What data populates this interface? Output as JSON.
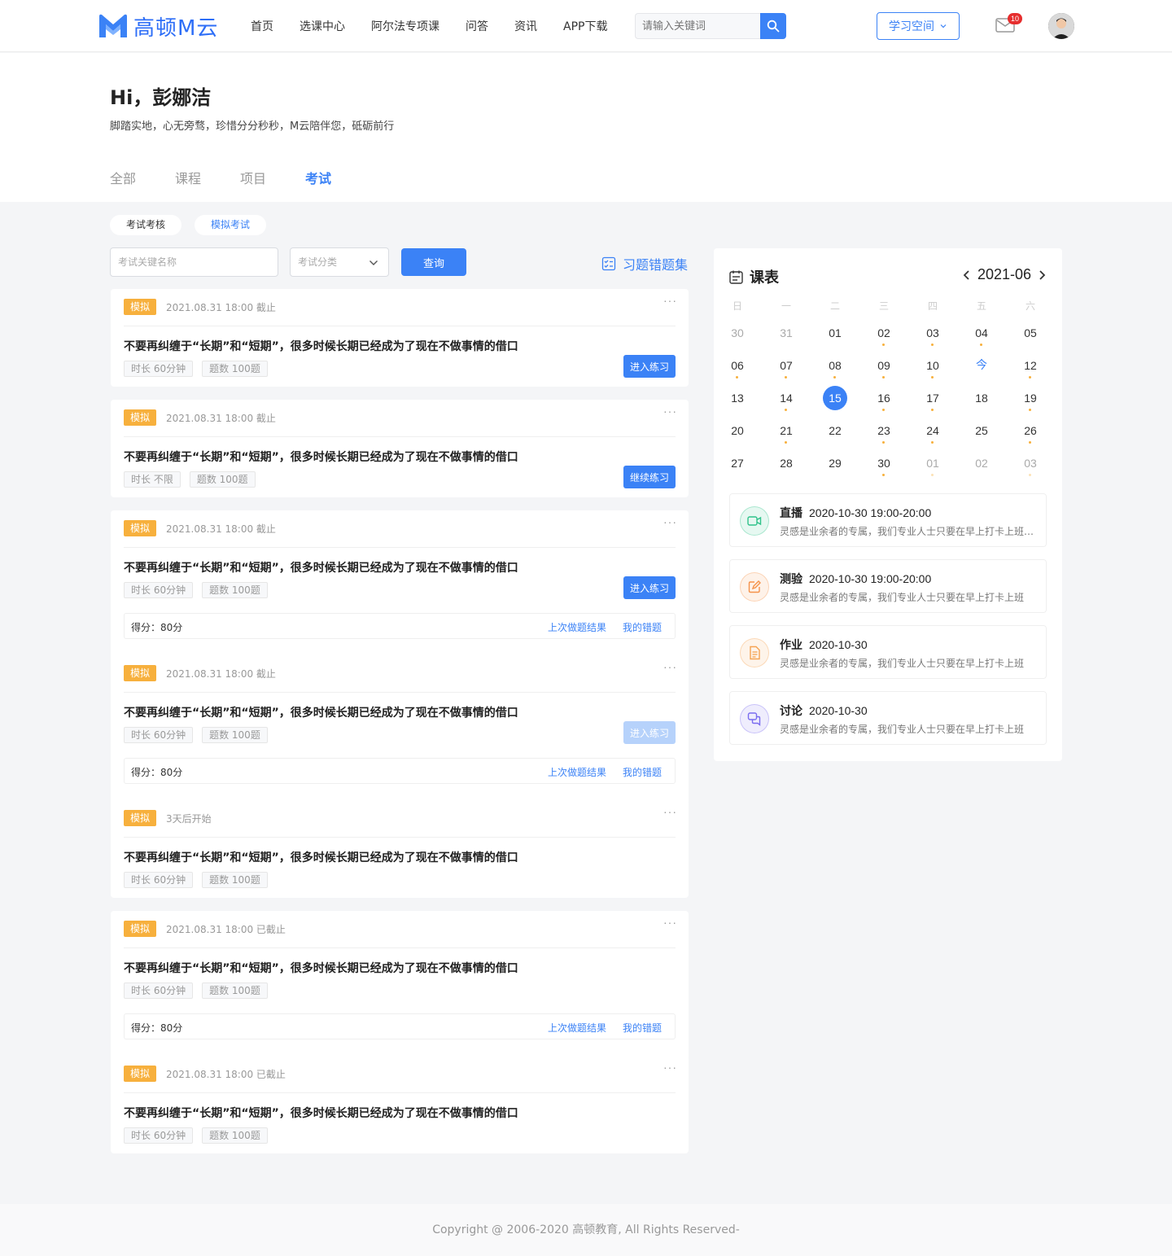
{
  "header": {
    "brand": "高顿M云",
    "nav": [
      "首页",
      "选课中心",
      "阿尔法专项课",
      "问答",
      "资讯",
      "APP下载"
    ],
    "search_placeholder": "请输入关键词",
    "space_label": "学习空间",
    "mail_count": "10",
    "brand_color": "#3b82f6"
  },
  "hero": {
    "greeting": "Hi，彭娜洁",
    "motto": "脚踏实地，心无旁骛，珍惜分分秒秒，M云陪伴您，砥砺前行",
    "tabs": [
      "全部",
      "课程",
      "项目",
      "考试"
    ],
    "active_tab": "考试"
  },
  "filters": {
    "pills": [
      "考试考核",
      "模拟考试"
    ],
    "active_pill": "模拟考试",
    "keyword_placeholder": "考试关键名称",
    "category_placeholder": "考试分类",
    "query_label": "查询",
    "wrong_set_label": "习题错题集"
  },
  "exams": [
    {
      "tag": "模拟",
      "deadline": "2021.08.31 18:00 截止",
      "title": "不要再纠缠于“长期”和“短期”，很多时候长期已经成为了现在不做事情的借口",
      "duration": "时长 60分钟",
      "count": "题数 100题",
      "action": "进入练习",
      "action_state": "enabled"
    },
    {
      "tag": "模拟",
      "deadline": "2021.08.31 18:00 截止",
      "title": "不要再纠缠于“长期”和“短期”，很多时候长期已经成为了现在不做事情的借口",
      "duration": "时长 不限",
      "count": "题数 100题",
      "action": "继续练习",
      "action_state": "enabled"
    },
    {
      "tag": "模拟",
      "deadline": "2021.08.31 18:00 截止",
      "title": "不要再纠缠于“长期”和“短期”，很多时候长期已经成为了现在不做事情的借口",
      "duration": "时长 60分钟",
      "count": "题数 100题",
      "action": "进入练习",
      "action_state": "enabled",
      "score": "得分：80分",
      "last_result": "上次做题结果",
      "my_wrong": "我的错题"
    },
    {
      "tag": "模拟",
      "deadline": "2021.08.31 18:00 截止",
      "title": "不要再纠缠于“长期”和“短期”，很多时候长期已经成为了现在不做事情的借口",
      "duration": "时长 60分钟",
      "count": "题数 100题",
      "action": "进入练习",
      "action_state": "disabled",
      "score": "得分：80分",
      "last_result": "上次做题结果",
      "my_wrong": "我的错题"
    },
    {
      "tag": "模拟",
      "deadline": "3天后开始",
      "title": "不要再纠缠于“长期”和“短期”，很多时候长期已经成为了现在不做事情的借口",
      "duration": "时长 60分钟",
      "count": "题数 100题"
    },
    {
      "tag": "模拟",
      "deadline": "2021.08.31 18:00 已截止",
      "title": "不要再纠缠于“长期”和“短期”，很多时候长期已经成为了现在不做事情的借口",
      "duration": "时长 60分钟",
      "count": "题数 100题",
      "score": "得分：80分",
      "last_result": "上次做题结果",
      "my_wrong": "我的错题"
    },
    {
      "tag": "模拟",
      "deadline": "2021.08.31 18:00 已截止",
      "title": "不要再纠缠于“长期”和“短期”，很多时候长期已经成为了现在不做事情的借口",
      "duration": "时长 60分钟",
      "count": "题数 100题"
    }
  ],
  "calendar": {
    "title": "课表",
    "month": "2021-06",
    "weekdays": [
      "日",
      "一",
      "二",
      "三",
      "四",
      "五",
      "六"
    ],
    "weeks": [
      [
        {
          "d": "30",
          "m": true
        },
        {
          "d": "31",
          "m": true
        },
        {
          "d": "01"
        },
        {
          "d": "02",
          "dot": true
        },
        {
          "d": "03",
          "dot": true
        },
        {
          "d": "04",
          "dot": true
        },
        {
          "d": "05"
        }
      ],
      [
        {
          "d": "06",
          "dot": true
        },
        {
          "d": "07",
          "dot": true
        },
        {
          "d": "08",
          "dot": true
        },
        {
          "d": "09",
          "dot": true
        },
        {
          "d": "10",
          "dot": true
        },
        {
          "d": "今",
          "today": true
        },
        {
          "d": "12",
          "dot": true
        }
      ],
      [
        {
          "d": "13"
        },
        {
          "d": "14",
          "dot": true
        },
        {
          "d": "15",
          "sel": true
        },
        {
          "d": "16",
          "dot": true
        },
        {
          "d": "17",
          "dot": true
        },
        {
          "d": "18"
        },
        {
          "d": "19",
          "dot": true
        }
      ],
      [
        {
          "d": "20"
        },
        {
          "d": "21",
          "dot": true
        },
        {
          "d": "22"
        },
        {
          "d": "23",
          "dot": true
        },
        {
          "d": "24",
          "dot": true
        },
        {
          "d": "25"
        },
        {
          "d": "26",
          "dot": true
        }
      ],
      [
        {
          "d": "27"
        },
        {
          "d": "28"
        },
        {
          "d": "29"
        },
        {
          "d": "30",
          "dot": true
        },
        {
          "d": "01",
          "m": true,
          "faint": true
        },
        {
          "d": "02",
          "m": true
        },
        {
          "d": "03",
          "m": true,
          "faint": true
        }
      ]
    ],
    "events": [
      {
        "kind": "直播",
        "time": "2020-10-30 19:00-20:00",
        "desc": "灵感是业余者的专属，我们专业人士只要在早上打卡上班就可以了",
        "icon": "video-icon",
        "color": "#2fc28a"
      },
      {
        "kind": "测验",
        "time": "2020-10-30 19:00-20:00",
        "desc": "灵感是业余者的专属，我们专业人士只要在早上打卡上班",
        "icon": "edit-icon",
        "color": "#f5924a"
      },
      {
        "kind": "作业",
        "time": "2020-10-30",
        "desc": "灵感是业余者的专属，我们专业人士只要在早上打卡上班",
        "icon": "document-icon",
        "color": "#f5a352"
      },
      {
        "kind": "讨论",
        "time": "2020-10-30",
        "desc": "灵感是业余者的专属，我们专业人士只要在早上打卡上班",
        "icon": "chat-icon",
        "color": "#7a6cf0"
      }
    ]
  },
  "footer": {
    "copyright": "Copyright @ 2006-2020 高顿教育, All Rights Reserved-"
  }
}
